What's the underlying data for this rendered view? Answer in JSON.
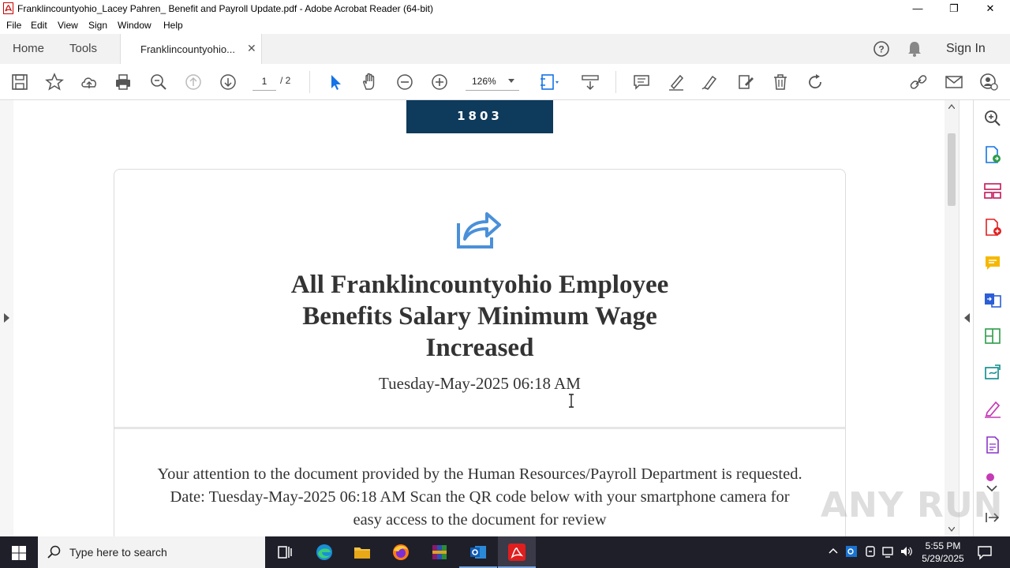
{
  "window": {
    "title": "Franklincountyohio_Lacey Pahren_ Benefit and Payroll Update.pdf - Adobe Acrobat Reader (64-bit)",
    "controls": {
      "minimize": "—",
      "maximize": "❐",
      "close": "✕"
    }
  },
  "menu": [
    "File",
    "Edit",
    "View",
    "Sign",
    "Window",
    "Help"
  ],
  "tabs": {
    "home": "Home",
    "tools": "Tools",
    "document": "Franklincountyohio...",
    "sign_in": "Sign In"
  },
  "toolbar": {
    "page_current": "1",
    "page_total": "/ 2",
    "zoom": "126%"
  },
  "document": {
    "logo_text": "1803",
    "headline": "All Franklincountyohio Employee Benefits Salary Minimum Wage Increased",
    "date": "Tuesday-May-2025 06:18 AM",
    "body": "Your attention to the document provided by the Human Resources/Payroll Department is requested. Date: Tuesday-May-2025 06:18 AM Scan the QR code below with your smartphone camera for easy access to the document for review"
  },
  "watermark": "ANY RUN",
  "taskbar": {
    "search_placeholder": "Type here to search",
    "time": "5:55 PM",
    "date": "5/29/2025"
  },
  "colors": {
    "accent_blue": "#1473e6",
    "logo_navy": "#0e3a5b",
    "share_icon": "#4a90d9"
  }
}
